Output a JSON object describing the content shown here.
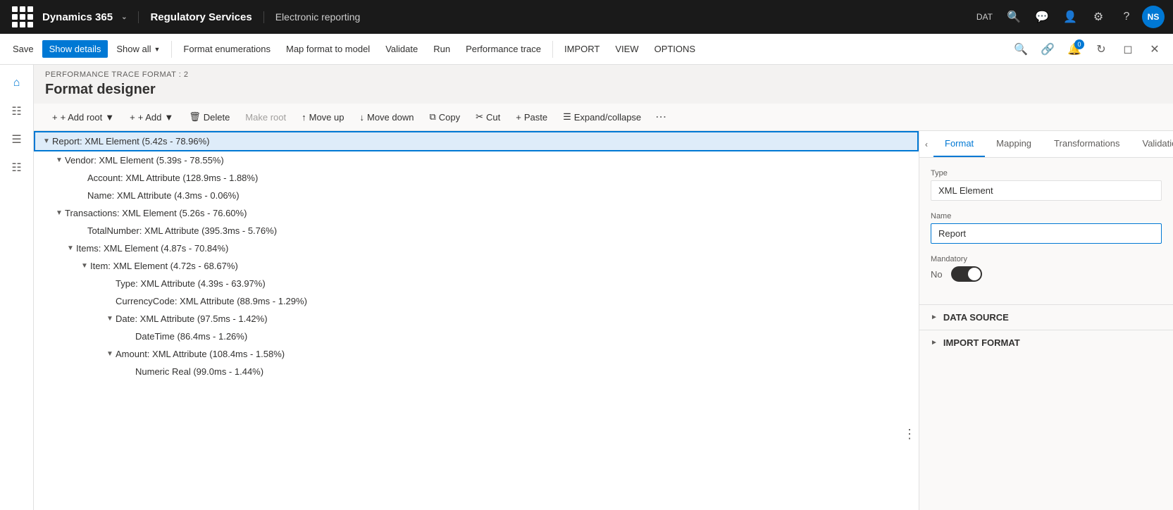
{
  "topbar": {
    "brand": "Dynamics 365",
    "module": "Regulatory Services",
    "page": "Electronic reporting",
    "env_label": "DAT",
    "avatar": "NS"
  },
  "cmdbar": {
    "save": "Save",
    "show_details": "Show details",
    "show_all": "Show all",
    "format_enumerations": "Format enumerations",
    "map_format": "Map format to model",
    "validate": "Validate",
    "run": "Run",
    "perf_trace": "Performance trace",
    "import": "IMPORT",
    "view": "VIEW",
    "options": "OPTIONS"
  },
  "breadcrumb": "PERFORMANCE TRACE FORMAT : 2",
  "page_title": "Format designer",
  "toolbar": {
    "add_root": "+ Add root",
    "add": "+ Add",
    "delete": "Delete",
    "make_root": "Make root",
    "move_up": "Move up",
    "move_down": "Move down",
    "copy": "Copy",
    "cut": "Cut",
    "paste": "Paste",
    "expand_collapse": "Expand/collapse"
  },
  "tree_items": [
    {
      "id": 1,
      "indent": 0,
      "has_chevron": true,
      "expanded": true,
      "text": "Report: XML Element (5.42s - 78.96%)",
      "selected": true
    },
    {
      "id": 2,
      "indent": 1,
      "has_chevron": true,
      "expanded": true,
      "text": "Vendor: XML Element (5.39s - 78.55%)"
    },
    {
      "id": 3,
      "indent": 2,
      "has_chevron": false,
      "expanded": false,
      "text": "Account: XML Attribute (128.9ms - 1.88%)"
    },
    {
      "id": 4,
      "indent": 2,
      "has_chevron": false,
      "expanded": false,
      "text": "Name: XML Attribute (4.3ms - 0.06%)"
    },
    {
      "id": 5,
      "indent": 1,
      "has_chevron": true,
      "expanded": true,
      "text": "Transactions: XML Element (5.26s - 76.60%)"
    },
    {
      "id": 6,
      "indent": 2,
      "has_chevron": false,
      "expanded": false,
      "text": "TotalNumber: XML Attribute (395.3ms - 5.76%)"
    },
    {
      "id": 7,
      "indent": 2,
      "has_chevron": true,
      "expanded": true,
      "text": "Items: XML Element (4.87s - 70.84%)"
    },
    {
      "id": 8,
      "indent": 3,
      "has_chevron": true,
      "expanded": true,
      "text": "Item: XML Element (4.72s - 68.67%)"
    },
    {
      "id": 9,
      "indent": 4,
      "has_chevron": false,
      "expanded": false,
      "text": "Type: XML Attribute (4.39s - 63.97%)"
    },
    {
      "id": 10,
      "indent": 4,
      "has_chevron": false,
      "expanded": false,
      "text": "CurrencyCode: XML Attribute (88.9ms - 1.29%)"
    },
    {
      "id": 11,
      "indent": 4,
      "has_chevron": true,
      "expanded": true,
      "text": "Date: XML Attribute (97.5ms - 1.42%)"
    },
    {
      "id": 12,
      "indent": 5,
      "has_chevron": false,
      "expanded": false,
      "text": "DateTime (86.4ms - 1.26%)"
    },
    {
      "id": 13,
      "indent": 4,
      "has_chevron": true,
      "expanded": true,
      "text": "Amount: XML Attribute (108.4ms - 1.58%)"
    },
    {
      "id": 14,
      "indent": 5,
      "has_chevron": false,
      "expanded": false,
      "text": "Numeric Real (99.0ms - 1.44%)"
    }
  ],
  "right_panel": {
    "tabs": [
      "Format",
      "Mapping",
      "Transformations",
      "Validations"
    ],
    "active_tab": "Format",
    "type_label": "Type",
    "type_value": "XML Element",
    "name_label": "Name",
    "name_value": "Report",
    "mandatory_label": "Mandatory",
    "mandatory_no": "No",
    "data_source_label": "DATA SOURCE",
    "import_format_label": "IMPORT FORMAT"
  }
}
